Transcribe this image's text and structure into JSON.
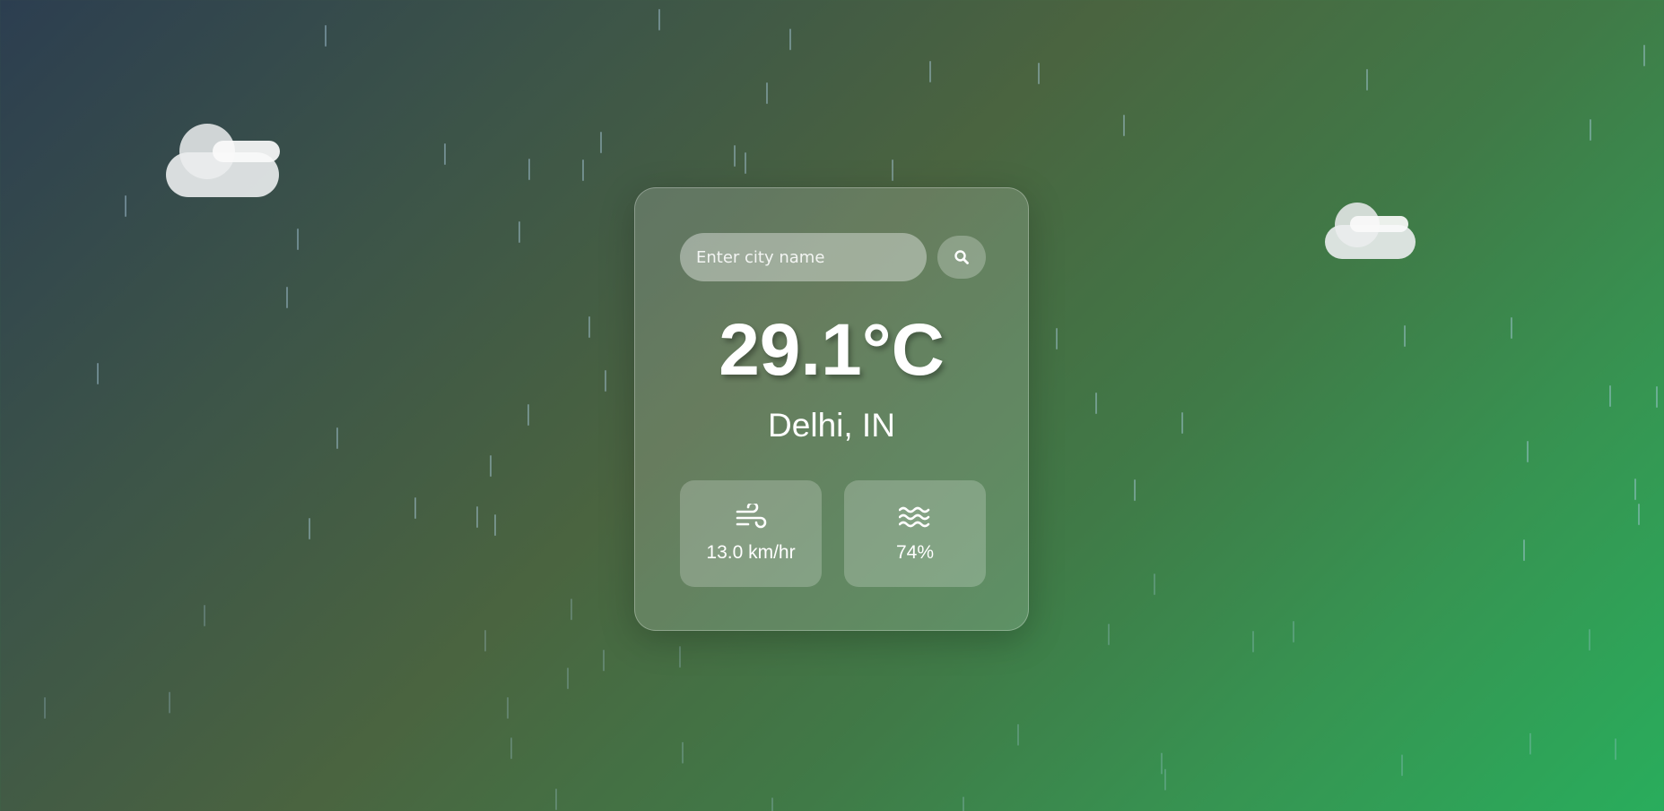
{
  "search": {
    "placeholder": "Enter city name",
    "value": ""
  },
  "weather": {
    "temperature": "29.1°C",
    "location": "Delhi, IN",
    "wind_speed": "13.0 km/hr",
    "humidity": "74%"
  },
  "icons": {
    "search": "magnifying-glass",
    "wind": "wind",
    "humidity": "water-waves",
    "background": "cloud-with-sun"
  },
  "colors": {
    "background_start": "#2c3e50",
    "background_end": "#29ad5c",
    "text": "#ffffff"
  }
}
